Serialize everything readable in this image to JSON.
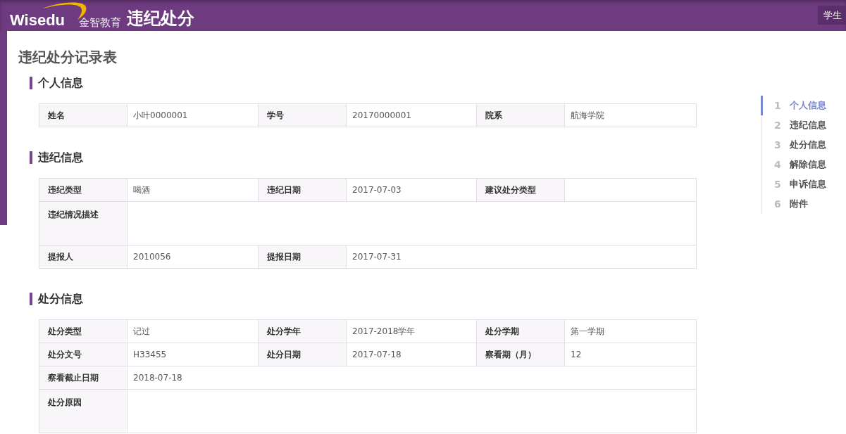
{
  "header": {
    "logo_text": "Wisedu",
    "logo_subtext": "金智教育",
    "title": "违纪处分",
    "right_button": "学生"
  },
  "page_title": "违纪处分记录表",
  "sections": [
    {
      "title": "个人信息",
      "rows": [
        {
          "kind": "normal",
          "fields": [
            {
              "label": "姓名",
              "value": "小叶0000001"
            },
            {
              "label": "学号",
              "value": "20170000001"
            },
            {
              "label": "院系",
              "value": "航海学院"
            }
          ]
        }
      ]
    },
    {
      "title": "违纪信息",
      "rows": [
        {
          "kind": "normal",
          "fields": [
            {
              "label": "违纪类型",
              "value": "喝酒"
            },
            {
              "label": "违纪日期",
              "value": "2017-07-03"
            },
            {
              "label": "建议处分类型"
            }
          ]
        },
        {
          "kind": "tall",
          "fields": [
            {
              "label": "违纪情况描述"
            }
          ]
        },
        {
          "kind": "normal",
          "fields": [
            {
              "label": "提报人",
              "value": "2010056"
            },
            {
              "label": "提报日期",
              "value": "2017-07-31"
            }
          ]
        }
      ]
    },
    {
      "title": "处分信息",
      "rows": [
        {
          "kind": "normal",
          "fields": [
            {
              "label": "处分类型",
              "value": "记过"
            },
            {
              "label": "处分学年",
              "value": "2017-2018学年"
            },
            {
              "label": "处分学期",
              "value": "第一学期"
            }
          ]
        },
        {
          "kind": "normal",
          "fields": [
            {
              "label": "处分文号",
              "value": "H33455"
            },
            {
              "label": "处分日期",
              "value": "2017-07-18"
            },
            {
              "label": "察看期（月）",
              "value": "12"
            }
          ]
        },
        {
          "kind": "normal",
          "fields": [
            {
              "label": "察看截止日期",
              "value": "2018-07-18"
            }
          ]
        },
        {
          "kind": "tall",
          "fields": [
            {
              "label": "处分原因"
            }
          ]
        }
      ]
    }
  ],
  "nav": [
    {
      "number": "1",
      "label": "个人信息",
      "selected": true
    },
    {
      "number": "2",
      "label": "违纪信息",
      "selected": false
    },
    {
      "number": "3",
      "label": "处分信息",
      "selected": false
    },
    {
      "number": "4",
      "label": "解除信息",
      "selected": false
    },
    {
      "number": "5",
      "label": "申诉信息",
      "selected": false
    },
    {
      "number": "6",
      "label": "附件",
      "selected": false
    }
  ]
}
